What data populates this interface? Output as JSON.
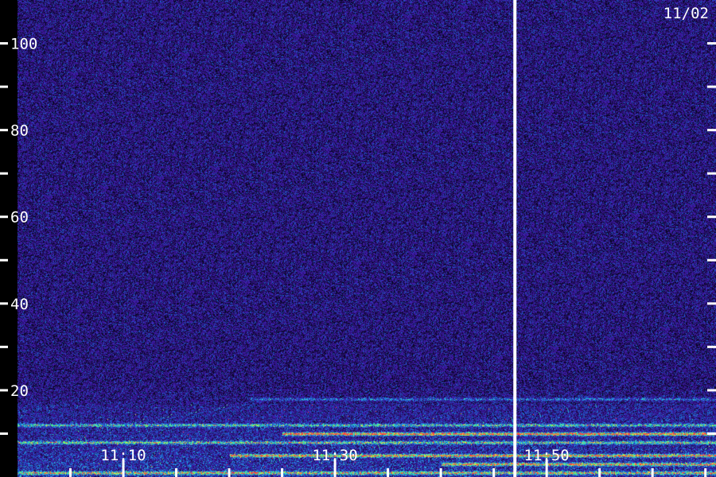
{
  "chart_data": {
    "type": "heatmap",
    "date_label": "11/02",
    "y_ticks": [
      {
        "value": 100,
        "label": "100"
      },
      {
        "value": 90,
        "label": ""
      },
      {
        "value": 80,
        "label": "80"
      },
      {
        "value": 70,
        "label": ""
      },
      {
        "value": 60,
        "label": "60"
      },
      {
        "value": 50,
        "label": ""
      },
      {
        "value": 40,
        "label": "40"
      },
      {
        "value": 30,
        "label": ""
      },
      {
        "value": 20,
        "label": "20"
      },
      {
        "value": 10,
        "label": ""
      }
    ],
    "ylim": [
      0,
      110
    ],
    "x_labels": [
      {
        "time": "11:10",
        "label": "11:10"
      },
      {
        "time": "11:30",
        "label": "11:30"
      },
      {
        "time": "11:50",
        "label": "11:50"
      }
    ],
    "x_ticks": [
      "11:05",
      "11:10",
      "11:15",
      "11:20",
      "11:25",
      "11:30",
      "11:35",
      "11:40",
      "11:45",
      "11:50",
      "11:55",
      "12:00",
      "12:05"
    ],
    "xlim": [
      "11:00",
      "12:06"
    ],
    "marker_time": "11:47",
    "colors": {
      "background": "#1a0a5a",
      "low": "#3a1a9a",
      "mid": "#1f7fe0",
      "high": "#46f58a",
      "peak": "#ffd23a",
      "hot": "#ff4040",
      "axis": "#ffffff"
    },
    "bands": [
      {
        "freq": 18,
        "start": "11:22",
        "end": "12:06",
        "strength": 0.35
      },
      {
        "freq": 12,
        "start": "11:00",
        "end": "12:06",
        "strength": 0.55
      },
      {
        "freq": 10,
        "start": "11:25",
        "end": "12:06",
        "strength": 0.95
      },
      {
        "freq": 8,
        "start": "11:00",
        "end": "12:06",
        "strength": 0.6
      },
      {
        "freq": 5,
        "start": "11:20",
        "end": "12:06",
        "strength": 0.85
      },
      {
        "freq": 3,
        "start": "11:40",
        "end": "12:06",
        "strength": 0.8
      },
      {
        "freq": 1,
        "start": "11:00",
        "end": "12:06",
        "strength": 0.7
      }
    ]
  }
}
